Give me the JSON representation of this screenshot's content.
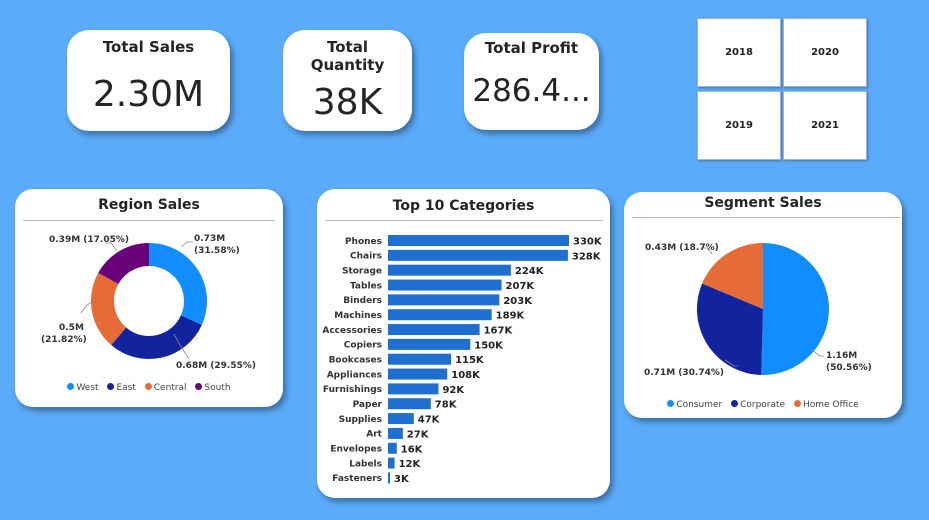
{
  "kpis": {
    "sales": {
      "title": "Total Sales",
      "value": "2.30M"
    },
    "quantity": {
      "title_line1": "Total",
      "title_line2": "Quantity",
      "value": "38K"
    },
    "profit": {
      "title": "Total Profit",
      "value": "286.4..."
    }
  },
  "slicer": {
    "years": [
      "2018",
      "2020",
      "2019",
      "2021"
    ]
  },
  "colors": {
    "background": "#5aabf9",
    "bar": "#1f6fd0",
    "west": "#118dff",
    "east": "#12239e",
    "central": "#e66c37",
    "south": "#6b007b"
  },
  "region": {
    "title": "Region Sales",
    "legend": [
      {
        "name": "West",
        "color": "#118dff"
      },
      {
        "name": "East",
        "color": "#12239e"
      },
      {
        "name": "Central",
        "color": "#e66c37"
      },
      {
        "name": "South",
        "color": "#6b007b"
      }
    ],
    "labels": {
      "west_1": "0.73M",
      "west_2": "(31.58%)",
      "east": "0.68M (29.55%)",
      "central_1": "0.5M",
      "central_2": "(21.82%)",
      "south": "0.39M (17.05%)"
    }
  },
  "categories": {
    "title": "Top 10 Categories"
  },
  "segment": {
    "title": "Segment Sales",
    "legend": [
      {
        "name": "Consumer",
        "color": "#118dff"
      },
      {
        "name": "Corporate",
        "color": "#12239e"
      },
      {
        "name": "Home Office",
        "color": "#e66c37"
      }
    ],
    "labels": {
      "consumer_1": "1.16M",
      "consumer_2": "(50.56%)",
      "corporate": "0.71M (30.74%)",
      "home_office": "0.43M (18.7%)"
    }
  },
  "chart_data": [
    {
      "type": "pie",
      "title": "Region Sales",
      "donut": true,
      "categories": [
        "West",
        "East",
        "Central",
        "South"
      ],
      "values": [
        0.73,
        0.68,
        0.5,
        0.39
      ],
      "percent": [
        31.58,
        29.55,
        21.82,
        17.05
      ],
      "unit": "M",
      "legend_position": "bottom"
    },
    {
      "type": "bar",
      "orientation": "horizontal",
      "title": "Top 10 Categories",
      "categories": [
        "Phones",
        "Chairs",
        "Storage",
        "Tables",
        "Binders",
        "Machines",
        "Accessories",
        "Copiers",
        "Bookcases",
        "Appliances",
        "Furnishings",
        "Paper",
        "Supplies",
        "Art",
        "Envelopes",
        "Labels",
        "Fasteners"
      ],
      "values": [
        330,
        328,
        224,
        207,
        203,
        189,
        167,
        150,
        115,
        108,
        92,
        78,
        47,
        27,
        16,
        12,
        3
      ],
      "value_labels": [
        "330K",
        "328K",
        "224K",
        "207K",
        "203K",
        "189K",
        "167K",
        "150K",
        "115K",
        "108K",
        "92K",
        "78K",
        "47K",
        "27K",
        "16K",
        "12K",
        "3K"
      ],
      "unit": "K"
    },
    {
      "type": "pie",
      "title": "Segment Sales",
      "categories": [
        "Consumer",
        "Corporate",
        "Home Office"
      ],
      "values": [
        1.16,
        0.71,
        0.43
      ],
      "percent": [
        50.56,
        30.74,
        18.7
      ],
      "unit": "M",
      "legend_position": "bottom"
    }
  ]
}
